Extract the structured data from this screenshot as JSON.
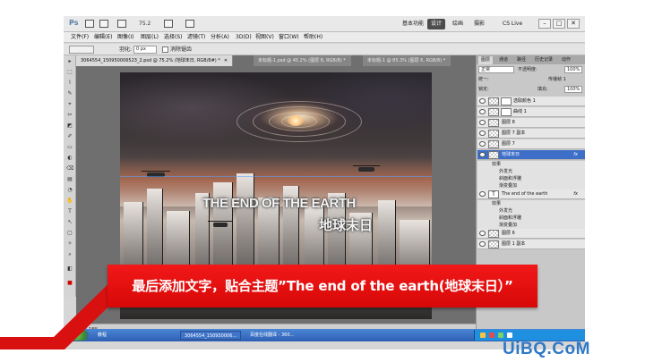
{
  "app": {
    "logo": "Ps",
    "zoom": "75.2",
    "workspaces": [
      "基本功能",
      "设计",
      "绘画",
      "摄影"
    ],
    "active_workspace": "设计",
    "cs_live": "CS Live",
    "window_controls": [
      "–",
      "□",
      "✕"
    ]
  },
  "menu": {
    "items": [
      "文件(F)",
      "编辑(E)",
      "图像(I)",
      "图层(L)",
      "选择(S)",
      "滤镜(T)",
      "分析(A)",
      "3D(D)",
      "视图(V)",
      "窗口(W)",
      "帮助(H)"
    ]
  },
  "options_bar": {
    "feather_label": "羽化:",
    "feather_value": "0 px",
    "antialias_label": "消除锯齿"
  },
  "tools": [
    "▸",
    "⬚",
    "⌇",
    "✎",
    "⌖",
    "✂",
    "◩",
    "✐",
    "▭",
    "◐",
    "⌫",
    "▤",
    "◔",
    "✋",
    "T",
    "↖",
    "▢",
    "✧",
    "⌕",
    "◧",
    "■"
  ],
  "document": {
    "tabs": [
      {
        "label": "3064554_150950006523_2.psd @ 75.2% (地球末日, RGB/8#) *",
        "active": true
      },
      {
        "label": "未标题-1.psd @ 45.2% (图层 8, RGB/8) *",
        "active": false
      },
      {
        "label": "未标题-1 @ 85.3% (图层 6, RGB/8) *",
        "active": false
      }
    ],
    "canvas_title": "THE END OF THE EARTH",
    "canvas_subtitle": "地球末日",
    "status_zoom": "75.18%"
  },
  "panels": {
    "tabs": [
      "图层",
      "通道",
      "路径",
      "历史记录",
      "动作"
    ],
    "blend_mode": "正常",
    "opacity_label": "不透明度:",
    "opacity_value": "100%",
    "lock_label": "锁定:",
    "fill_label": "填充:",
    "fill_value": "100%",
    "unify_label": "统一:",
    "propagate_label": "传播帧 1",
    "layers": [
      {
        "name": "选取颜色 1",
        "kind": "adjustment"
      },
      {
        "name": "曲线 1",
        "kind": "adjustment"
      },
      {
        "name": "图层 8",
        "kind": "pixel"
      },
      {
        "name": "图层 7 副本",
        "kind": "pixel"
      },
      {
        "name": "图层 7",
        "kind": "pixel"
      },
      {
        "name": "地球末日",
        "kind": "pixel",
        "selected": true,
        "fx": "fx"
      },
      {
        "name": "效果",
        "kind": "sub"
      },
      {
        "name": "外发光",
        "kind": "sub"
      },
      {
        "name": "斜面和浮雕",
        "kind": "sub"
      },
      {
        "name": "渐变叠加",
        "kind": "sub"
      },
      {
        "name": "The end of the earth",
        "kind": "text",
        "fx": "fx"
      },
      {
        "name": "效果",
        "kind": "sub"
      },
      {
        "name": "外发光",
        "kind": "sub"
      },
      {
        "name": "斜面和浮雕",
        "kind": "sub"
      },
      {
        "name": "渐变叠加",
        "kind": "sub"
      },
      {
        "name": "图层 6",
        "kind": "pixel"
      },
      {
        "name": "图层 1 副本",
        "kind": "pixel"
      }
    ]
  },
  "taskbar": {
    "items": [
      "教程",
      "3064554_150950006...",
      "百度在线翻译 - 360..."
    ]
  },
  "banner": {
    "text": "最后添加文字，贴合主题”The end of the earth(地球末日）”"
  },
  "watermark": "UiBQ.CoM"
}
